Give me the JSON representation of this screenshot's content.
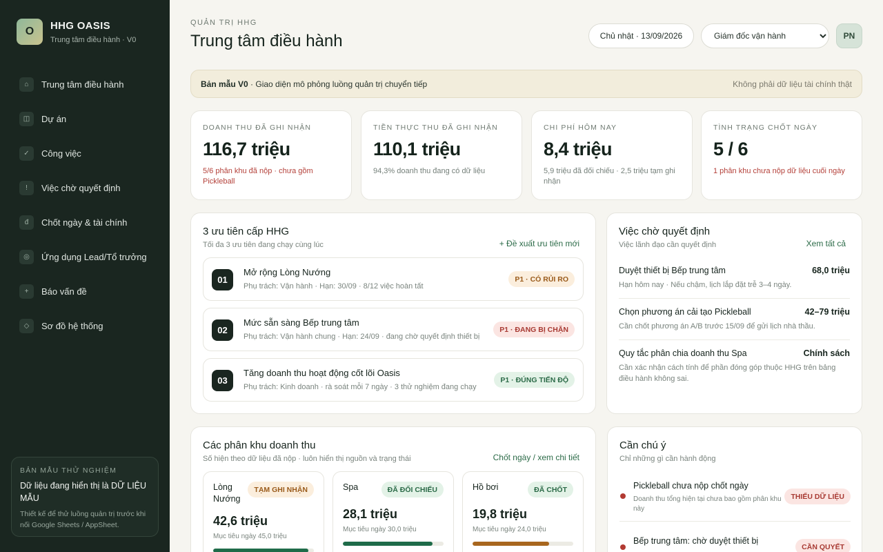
{
  "brand": {
    "logo_letter": "O",
    "name": "HHG OASIS",
    "subtitle": "Trung tâm điều hành · V0"
  },
  "sidebar": {
    "items": [
      {
        "icon": "home-icon",
        "glyph": "⌂",
        "label": "Trung tâm điều hành"
      },
      {
        "icon": "project-icon",
        "glyph": "◫",
        "label": "Dự án"
      },
      {
        "icon": "check-icon",
        "glyph": "✓",
        "label": "Công việc"
      },
      {
        "icon": "alert-icon",
        "glyph": "!",
        "label": "Việc chờ quyết định"
      },
      {
        "icon": "currency-icon",
        "glyph": "đ",
        "label": "Chốt ngày & tài chính"
      },
      {
        "icon": "app-icon",
        "glyph": "◎",
        "label": "Ứng dụng Lead/Tổ trưởng"
      },
      {
        "icon": "plus-icon",
        "glyph": "+",
        "label": "Báo vấn đề"
      },
      {
        "icon": "diagram-icon",
        "glyph": "◇",
        "label": "Sơ đồ hệ thống"
      }
    ],
    "sandbox": {
      "kicker": "BẢN MẪU THỬ NGHIỆM",
      "title": "Dữ liệu đang hiển thị là DỮ LIỆU MẪU",
      "text": "Thiết kế để thử luồng quản trị trước khi nối Google Sheets / AppSheet."
    }
  },
  "header": {
    "kicker": "QUẢN TRỊ HHG",
    "title": "Trung tâm điều hành",
    "date": "Chủ nhật · 13/09/2026",
    "role_selected": "Giám đốc vận hành",
    "avatar": "PN"
  },
  "banner": {
    "strong": "Bản mẫu V0",
    "rest": " · Giao diện mô phỏng luồng quản trị chuyển tiếp",
    "right": "Không phải dữ liệu tài chính thật"
  },
  "kpis": [
    {
      "label": "DOANH THU ĐÃ GHI NHẬN",
      "value": "116,7 triệu",
      "note": "5/6 phân khu đã nộp · chưa gồm Pickleball",
      "tone": "red"
    },
    {
      "label": "TIỀN THỰC THU ĐÃ GHI NHẬN",
      "value": "110,1 triệu",
      "note": "94,3% doanh thu đang có dữ liệu",
      "tone": "muted"
    },
    {
      "label": "CHI PHÍ HÔM NAY",
      "value": "8,4 triệu",
      "note": "5,9 triệu đã đối chiếu · 2,5 triệu tạm ghi nhận",
      "tone": "muted"
    },
    {
      "label": "TÌNH TRẠNG CHỐT NGÀY",
      "value": "5 / 6",
      "note": "1 phân khu chưa nộp dữ liệu cuối ngày",
      "tone": "red"
    }
  ],
  "priorities": {
    "title": "3 ưu tiên cấp HHG",
    "subtitle": "Tối đa 3 ưu tiên đang chạy cùng lúc",
    "link": "+ Đề xuất ưu tiên mới",
    "items": [
      {
        "num": "01",
        "title": "Mở rộng Lòng Nướng",
        "meta": "Phụ trách: Vận hành · Hạn: 30/09 · 8/12 việc hoàn tất",
        "badge": "P1 · CÓ RỦI RO",
        "tone": "amber"
      },
      {
        "num": "02",
        "title": "Mức sẵn sàng Bếp trung tâm",
        "meta": "Phụ trách: Vận hành chung · Hạn: 24/09 · đang chờ quyết định thiết bị",
        "badge": "P1 · ĐANG BỊ CHẶN",
        "tone": "red"
      },
      {
        "num": "03",
        "title": "Tăng doanh thu hoạt động cốt lõi Oasis",
        "meta": "Phụ trách: Kinh doanh · rà soát mỗi 7 ngày · 3 thử nghiệm đang chạy",
        "badge": "P1 · ĐÚNG TIẾN ĐỘ",
        "tone": "green"
      }
    ]
  },
  "decisions": {
    "title": "Việc chờ quyết định",
    "subtitle": "Việc lãnh đạo cần quyết định",
    "link": "Xem tất cả",
    "items": [
      {
        "title": "Duyệt thiết bị Bếp trung tâm",
        "amount": "68,0 triệu",
        "note": "Hạn hôm nay · Nếu chậm, lịch lắp đặt trễ 3–4 ngày."
      },
      {
        "title": "Chọn phương án cải tạo Pickleball",
        "amount": "42–79 triệu",
        "note": "Cần chốt phương án A/B trước 15/09 để gửi lịch nhà thầu."
      },
      {
        "title": "Quy tắc phân chia doanh thu Spa",
        "amount": "Chính sách",
        "note": "Cần xác nhận cách tính để phần đóng góp thuộc HHG trên bảng điều hành không sai."
      }
    ]
  },
  "zones": {
    "title": "Các phân khu doanh thu",
    "subtitle": "Số hiện theo dữ liệu đã nộp · luôn hiển thị nguồn và trạng thái",
    "link": "Chốt ngày / xem chi tiết",
    "items": [
      {
        "name": "Lòng Nướng",
        "badge": "TẠM GHI NHẬN",
        "tone": "amber",
        "value": "42,6 triệu",
        "target": "Mục tiêu ngày 45,0 triệu",
        "progress": 0.947,
        "bar_color": "#1f6b49"
      },
      {
        "name": "Spa",
        "badge": "ĐÃ ĐỐI CHIẾU",
        "tone": "green",
        "value": "28,1 triệu",
        "target": "Mục tiêu ngày 30,0 triệu",
        "progress": 0.887,
        "bar_color": "#1f6b49"
      },
      {
        "name": "Hồ bơi",
        "badge": "ĐÃ CHỐT",
        "tone": "green",
        "value": "19,8 triệu",
        "target": "Mục tiêu ngày 24,0 triệu",
        "progress": 0.76,
        "bar_color": "#a8661e"
      }
    ]
  },
  "attention": {
    "title": "Cần chú ý",
    "subtitle": "Chỉ những gì cần hành động",
    "items": [
      {
        "title": "Pickleball chưa nộp chốt ngày",
        "note": "Doanh thu tổng hiện tại chưa bao gồm phân khu này",
        "badge": "THIẾU DỮ LIỆU"
      },
      {
        "title": "Bếp trung tâm: chờ duyệt thiết bị",
        "note": "",
        "badge": "CẦN QUYẾT"
      }
    ]
  }
}
